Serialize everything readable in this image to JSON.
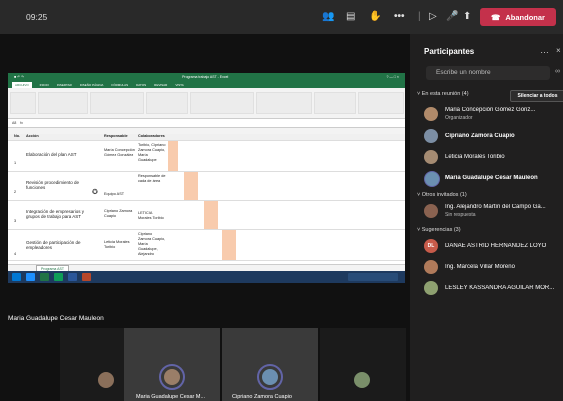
{
  "topbar": {
    "time": "09:25",
    "leave_label": "Abandonar",
    "icons": [
      "people-icon",
      "chat-icon",
      "raise-hand-icon",
      "more-icon",
      "camera-off-icon",
      "mic-icon",
      "share-icon",
      "phone-icon"
    ]
  },
  "shared_screen": {
    "app_title": "Programa trabajo AST - Excel",
    "ribbon_tabs": [
      "ARCHIVO",
      "INICIO",
      "INSERTAR",
      "DISEÑO PÁGINA",
      "FÓRMULAS",
      "DATOS",
      "REVISAR",
      "VISTA"
    ],
    "sheet_tab": "Programa AST",
    "headers": {
      "no": "No.",
      "accion": "Acción",
      "responsable": "Responsable",
      "colaboradores": "Colaboradores"
    },
    "rows": [
      {
        "no": "1",
        "accion": "Elaboración del plan AST",
        "responsable": "María Concepción Gómez González",
        "colaboradores": "Toribio, Cipriano Zamora Cuapio, María Guadalupe"
      },
      {
        "no": "2",
        "accion": "Revisión procedimiento de funciones",
        "responsable": "Equipo AST",
        "colaboradores": "Responsable de cada de área"
      },
      {
        "no": "3",
        "accion": "Integración de empresarios y grupos de trabajo para AST",
        "responsable": "Cipriano Zamora Cuapio",
        "colaboradores": "LETICIA Morales Toribio"
      },
      {
        "no": "4",
        "accion": "Gestión de participación de empleadores",
        "responsable": "Leticia Morales Toribio",
        "colaboradores": "Cipriano Zamora Cuapio, María Guadalupe, Alejandro"
      }
    ]
  },
  "speaker_name": "Maria Guadalupe Cesar Mauleon",
  "gallery": [
    {
      "name": "Maria Guadalupe Cesar M..."
    },
    {
      "name": "Cipriano Zamora Cuapio"
    }
  ],
  "panel": {
    "title": "Participantes",
    "search_placeholder": "Escribe un nombre",
    "in_meeting_label": "En esta reunión (4)",
    "mute_all_label": "Silenciar a todos",
    "in_meeting": [
      {
        "name": "Maria Concepción Gómez Gonz...",
        "sub": "Organizador"
      },
      {
        "name": "Cipriano Zamora Cuapio",
        "sub": ""
      },
      {
        "name": "Leticia Morales Toribio",
        "sub": ""
      },
      {
        "name": "Maria Guadalupe Cesar Mauleon",
        "sub": ""
      }
    ],
    "others_label": "Otros invitados (1)",
    "others": [
      {
        "name": "Ing. Alejandro Martín del Campo Ga...",
        "sub": "Sin respuesta"
      }
    ],
    "suggestions_label": "Sugerencias (3)",
    "suggestions": [
      {
        "name": "DANAE ASTRID HERNANDEZ LOYO",
        "initials": "DL"
      },
      {
        "name": "Ing. Marcela Villar Moreno",
        "initials": ""
      },
      {
        "name": "LESLEY KASSANDRA AGUILAR MOR...",
        "initials": ""
      }
    ]
  },
  "colors": {
    "leave": "#c4314b",
    "excel_green": "#217346",
    "accent": "#6264a7",
    "highlight": "#f8cbad"
  }
}
